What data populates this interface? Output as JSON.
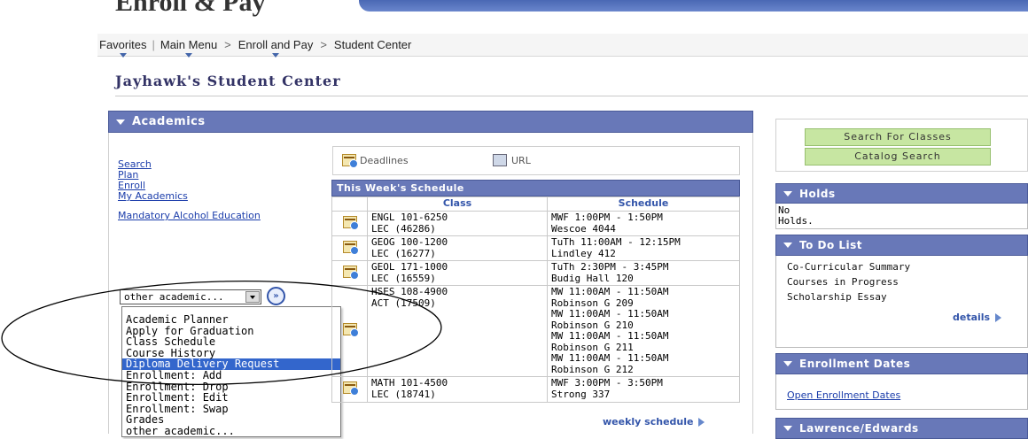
{
  "header": {
    "title": "Enroll & Pay"
  },
  "breadcrumb": {
    "favorites": "Favorites",
    "main_menu": "Main Menu",
    "enroll_and_pay": "Enroll and Pay",
    "current": "Student Center",
    "separator": ">"
  },
  "page_title": "Jayhawk's Student Center",
  "academics": {
    "header": "Academics",
    "links": [
      "Search",
      "Plan",
      "Enroll",
      "My Academics"
    ],
    "mandatory_link": "Mandatory Alcohol Education",
    "select_value": "other academic...",
    "go_symbol": "»",
    "dropdown_options": [
      "Academic Planner",
      "Apply for Graduation",
      "Class Schedule",
      "Course History",
      "Diploma Delivery Request",
      "Enrollment: Add",
      "Enrollment: Drop",
      "Enrollment: Edit",
      "Enrollment: Swap",
      "Grades",
      "other academic..."
    ],
    "selected_option": "Diploma Delivery Request"
  },
  "toolbar": {
    "deadlines": "Deadlines",
    "url": "URL"
  },
  "schedule": {
    "header": "This Week's Schedule",
    "col_class": "Class",
    "col_schedule": "Schedule",
    "rows": [
      {
        "class": [
          "ENGL 101-6250",
          "LEC (46286)"
        ],
        "schedule": [
          "MWF 1:00PM - 1:50PM",
          "Wescoe 4044"
        ]
      },
      {
        "class": [
          "GEOG 100-1200",
          "LEC (16277)"
        ],
        "schedule": [
          "TuTh 11:00AM - 12:15PM",
          "Lindley 412"
        ]
      },
      {
        "class": [
          "GEOL 171-1000",
          "LEC (16559)"
        ],
        "schedule": [
          "TuTh 2:30PM - 3:45PM",
          "Budig Hall 120"
        ]
      },
      {
        "class": [
          "HSES 108-4900",
          "ACT (17509)"
        ],
        "schedule": [
          "MW 11:00AM - 11:50AM",
          "Robinson G 209",
          "MW 11:00AM - 11:50AM",
          "Robinson G 210",
          "MW 11:00AM - 11:50AM",
          "Robinson G 211",
          "MW 11:00AM - 11:50AM",
          "Robinson G 212"
        ]
      },
      {
        "class": [
          "MATH 101-4500",
          "LEC (18741)"
        ],
        "schedule": [
          "MWF 3:00PM - 3:50PM",
          "Strong 337"
        ]
      }
    ],
    "weekly_link": "weekly schedule"
  },
  "right": {
    "search_for_classes": "Search For Classes",
    "catalog_search": "Catalog Search",
    "holds_header": "Holds",
    "holds_text": [
      "No",
      "Holds."
    ],
    "todo_header": "To Do List",
    "todo_items": [
      "Co-Curricular Summary",
      "Courses in Progress",
      "Scholarship Essay"
    ],
    "details_link": "details",
    "enrollment_dates_header": "Enrollment Dates",
    "open_enrollment_link": "Open Enrollment Dates",
    "lawrence_header": "Lawrence/Edwards"
  },
  "colors": {
    "section_header": "#6878b8",
    "link": "#1a3caa",
    "search_button": "#c7e6a2",
    "dropdown_selected": "#3366cc"
  }
}
